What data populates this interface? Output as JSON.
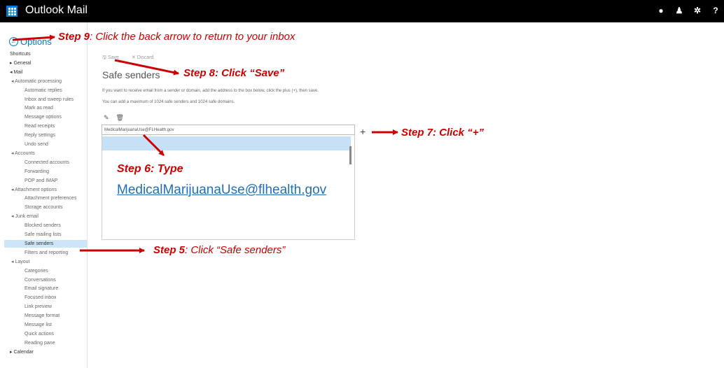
{
  "app": {
    "title": "Outlook Mail"
  },
  "options_title": "Options",
  "sidebar": {
    "items": [
      {
        "label": "Shortcuts",
        "style": "dark"
      },
      {
        "label": "▸ General",
        "style": "dark"
      },
      {
        "label": "◂ Mail",
        "style": "dark"
      },
      {
        "label": "◂ Automatic processing",
        "style": "section"
      },
      {
        "label": "Automatic replies",
        "style": "sub"
      },
      {
        "label": "Inbox and sweep rules",
        "style": "sub"
      },
      {
        "label": "Mark as read",
        "style": "sub"
      },
      {
        "label": "Message options",
        "style": "sub"
      },
      {
        "label": "Read receipts",
        "style": "sub"
      },
      {
        "label": "Reply settings",
        "style": "sub"
      },
      {
        "label": "Undo send",
        "style": "sub"
      },
      {
        "label": "◂ Accounts",
        "style": "section"
      },
      {
        "label": "Connected accounts",
        "style": "sub"
      },
      {
        "label": "Forwarding",
        "style": "sub"
      },
      {
        "label": "POP and IMAP",
        "style": "sub"
      },
      {
        "label": "◂ Attachment options",
        "style": "section"
      },
      {
        "label": "Attachment preferences",
        "style": "sub"
      },
      {
        "label": "Storage accounts",
        "style": "sub"
      },
      {
        "label": "◂ Junk email",
        "style": "section"
      },
      {
        "label": "Blocked senders",
        "style": "sub"
      },
      {
        "label": "Safe mailing lists",
        "style": "sub"
      },
      {
        "label": "Safe senders",
        "style": "selected"
      },
      {
        "label": "Filters and reporting",
        "style": "sub"
      },
      {
        "label": "◂ Layout",
        "style": "section"
      },
      {
        "label": "Categories",
        "style": "sub"
      },
      {
        "label": "Conversations",
        "style": "sub"
      },
      {
        "label": "Email signature",
        "style": "sub"
      },
      {
        "label": "Focused inbox",
        "style": "sub"
      },
      {
        "label": "Link preview",
        "style": "sub"
      },
      {
        "label": "Message format",
        "style": "sub"
      },
      {
        "label": "Message list",
        "style": "sub"
      },
      {
        "label": "Quick actions",
        "style": "sub"
      },
      {
        "label": "Reading pane",
        "style": "sub"
      },
      {
        "label": "▸ Calendar",
        "style": "dark"
      }
    ]
  },
  "toolbar": {
    "save_label": "Save",
    "discard_label": "Discard"
  },
  "main": {
    "title": "Safe senders",
    "desc1": "If you want to receive email from a sender or domain, add the address to the box below, click the plus (+), then save.",
    "desc2": "You can add a maximum of 1024 safe senders and 1024 safe domains.",
    "input_value": "MedicalMarijuanaUse@FLHealth.gov",
    "add_label": "+"
  },
  "annotations": {
    "step9_bold": "Step 9",
    "step9_text": ": Click the back arrow to return to your inbox",
    "step8": "Step 8: Click “Save”",
    "step7": "Step 7: Click “+”",
    "step6": "Step 6: Type",
    "step6_email": "MedicalMarijuanaUse@flhealth.gov",
    "step5_bold": "Step 5",
    "step5_text": ": Click “Safe senders”"
  },
  "colors": {
    "accent": "#0078d7",
    "annotation": "#cc0000",
    "selection": "#cde6f7"
  }
}
